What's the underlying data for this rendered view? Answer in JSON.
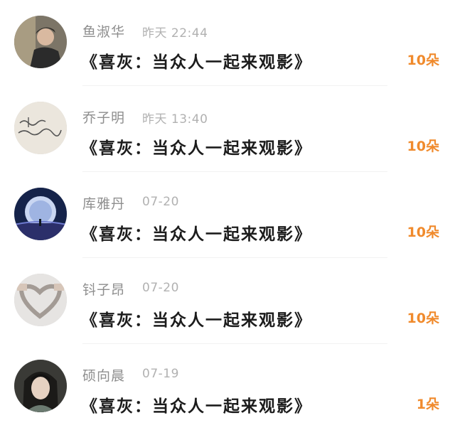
{
  "items": [
    {
      "name": "鱼淑华",
      "time": "昨天 22:44",
      "title": "《喜灰：当众人一起来观影》",
      "count": "10朵"
    },
    {
      "name": "乔子明",
      "time": "昨天 13:40",
      "title": "《喜灰：当众人一起来观影》",
      "count": "10朵"
    },
    {
      "name": "库雅丹",
      "time": "07-20",
      "title": "《喜灰：当众人一起来观影》",
      "count": "10朵"
    },
    {
      "name": "钭子昂",
      "time": "07-20",
      "title": "《喜灰：当众人一起来观影》",
      "count": "10朵"
    },
    {
      "name": "硕向晨",
      "time": "07-19",
      "title": "《喜灰：当众人一起来观影》",
      "count": "1朵"
    }
  ],
  "colors": {
    "count": "#f08a2c",
    "name": "#8e8e8e",
    "time": "#b1b1b1"
  }
}
